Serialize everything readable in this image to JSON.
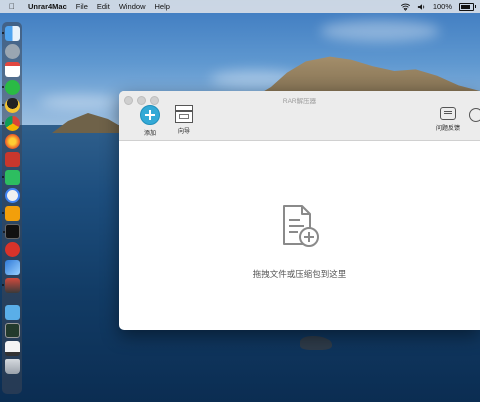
{
  "menubar": {
    "app_name": "Unrar4Mac",
    "menus": [
      "File",
      "Edit",
      "Window",
      "Help"
    ],
    "battery_text": "100%"
  },
  "window": {
    "title": "RAR解压器",
    "toolbar": {
      "add_label": "添加",
      "guide_label": "向导",
      "feedback_label": "问题反馈"
    },
    "dropzone": {
      "text": "拖拽文件或压缩包到这里"
    }
  },
  "colors": {
    "accent": "#33a9d6"
  }
}
